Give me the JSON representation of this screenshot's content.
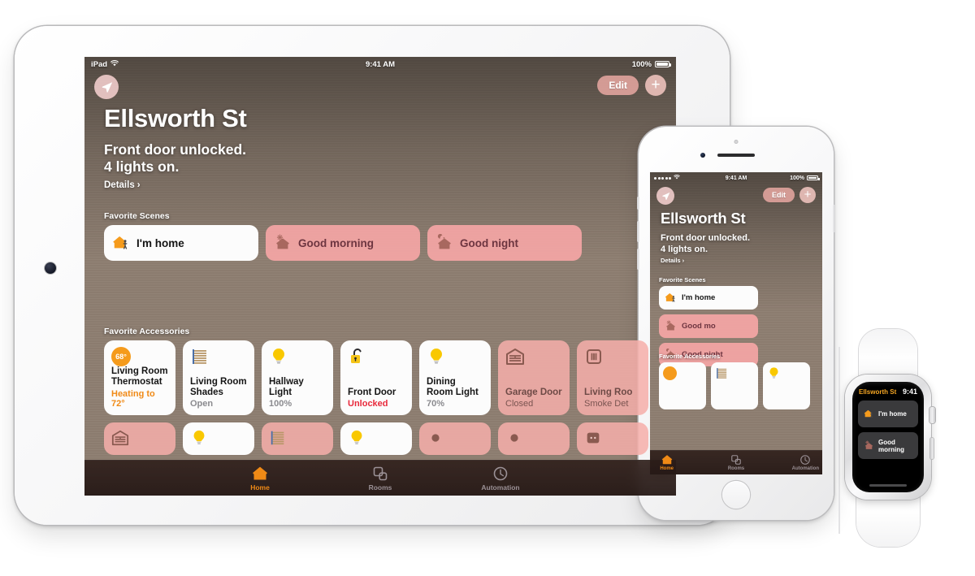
{
  "meta": {
    "scene_description": "Apple Home app shown on iPad, iPhone and Apple Watch",
    "accent_orange": "#f08a16",
    "accent_red": "#e8293b",
    "tint_pink": "#f7a6a6"
  },
  "ipad": {
    "statusbar": {
      "carrier": "iPad",
      "wifi_icon": "wifi-icon",
      "time": "9:41 AM",
      "battery_percent": "100%"
    },
    "header": {
      "location_icon": "location-arrow-icon",
      "edit_label": "Edit",
      "add_label": "+"
    },
    "home_name": "Ellsworth St",
    "status_line1": "Front door unlocked.",
    "status_line2": "4 lights on.",
    "details_label": "Details",
    "details_chevron": "›",
    "scenes_section_label": "Favorite Scenes",
    "scenes": [
      {
        "name": "I'm home",
        "icon": "house-person-icon",
        "style": "white"
      },
      {
        "name": "Good morning",
        "icon": "house-sun-icon",
        "style": "tint"
      },
      {
        "name": "Good night",
        "icon": "house-moon-icon",
        "style": "tint"
      }
    ],
    "accessories_section_label": "Favorite Accessories",
    "accessories": [
      {
        "name": "Living Room Thermostat",
        "status": "Heating to 72°",
        "status_style": "orange",
        "icon": "thermostat-icon",
        "badge": "68°",
        "style": "white"
      },
      {
        "name": "Living Room Shades",
        "status": "Open",
        "status_style": "grey",
        "icon": "blinds-icon",
        "style": "white"
      },
      {
        "name": "Hallway Light",
        "status": "100%",
        "status_style": "grey",
        "icon": "bulb-icon",
        "style": "white"
      },
      {
        "name": "Front Door",
        "status": "Unlocked",
        "status_style": "red",
        "icon": "unlocked-lock-icon",
        "style": "white"
      },
      {
        "name": "Dining Room Light",
        "status": "70%",
        "status_style": "grey",
        "icon": "bulb-icon",
        "style": "white"
      },
      {
        "name": "Garage Door",
        "status": "Closed",
        "status_style": "grey",
        "icon": "garage-door-icon",
        "style": "tint"
      },
      {
        "name": "Living Roo",
        "status": "Smoke Det",
        "status_style": "grey",
        "icon": "smoke-detector-icon",
        "style": "tint"
      }
    ],
    "accessories_row2": [
      {
        "icon": "garage-door-icon",
        "style": "tint"
      },
      {
        "icon": "bulb-icon",
        "style": "white"
      },
      {
        "icon": "blinds-icon",
        "style": "tint"
      },
      {
        "icon": "bulb-icon",
        "style": "white"
      },
      {
        "icon": "sensor-icon",
        "style": "tint"
      },
      {
        "icon": "sensor-icon",
        "style": "tint"
      },
      {
        "icon": "outlet-icon",
        "style": "tint"
      }
    ],
    "tabs": [
      {
        "label": "Home",
        "icon": "house-icon",
        "active": true
      },
      {
        "label": "Rooms",
        "icon": "rooms-icon",
        "active": false
      },
      {
        "label": "Automation",
        "icon": "clock-icon",
        "active": false
      }
    ]
  },
  "iphone": {
    "statusbar": {
      "signal_icon": "signal-dots-icon",
      "wifi_icon": "wifi-icon",
      "time": "9:41 AM",
      "battery_percent": "100%"
    },
    "header": {
      "location_icon": "location-arrow-icon",
      "edit_label": "Edit",
      "add_label": "+"
    },
    "home_name": "Ellsworth St",
    "status_line1": "Front door unlocked.",
    "status_line2": "4 lights on.",
    "details_label": "Details",
    "details_chevron": "›",
    "scenes_section_label": "Favorite Scenes",
    "scenes": [
      {
        "name": "I'm home",
        "icon": "house-person-icon",
        "style": "white"
      },
      {
        "name": "Good mo",
        "icon": "house-sun-icon",
        "style": "tint"
      },
      {
        "name": "Good night",
        "icon": "house-moon-icon",
        "style": "tint"
      }
    ],
    "accessories_section_label": "Favorite Accessories",
    "accessories": [
      {
        "icon": "thermostat-icon",
        "style": "white"
      },
      {
        "icon": "blinds-icon",
        "style": "white"
      },
      {
        "icon": "bulb-icon",
        "style": "white"
      }
    ],
    "tabs": [
      {
        "label": "Home",
        "icon": "house-icon",
        "active": true
      },
      {
        "label": "Rooms",
        "icon": "rooms-icon",
        "active": false
      },
      {
        "label": "Automation",
        "icon": "clock-icon",
        "active": false
      }
    ]
  },
  "watch": {
    "home_name": "Ellsworth St",
    "time": "9:41",
    "scenes": [
      {
        "name": "I'm home",
        "icon": "house-person-icon"
      },
      {
        "name": "Good morning",
        "icon": "house-sun-icon"
      }
    ]
  }
}
